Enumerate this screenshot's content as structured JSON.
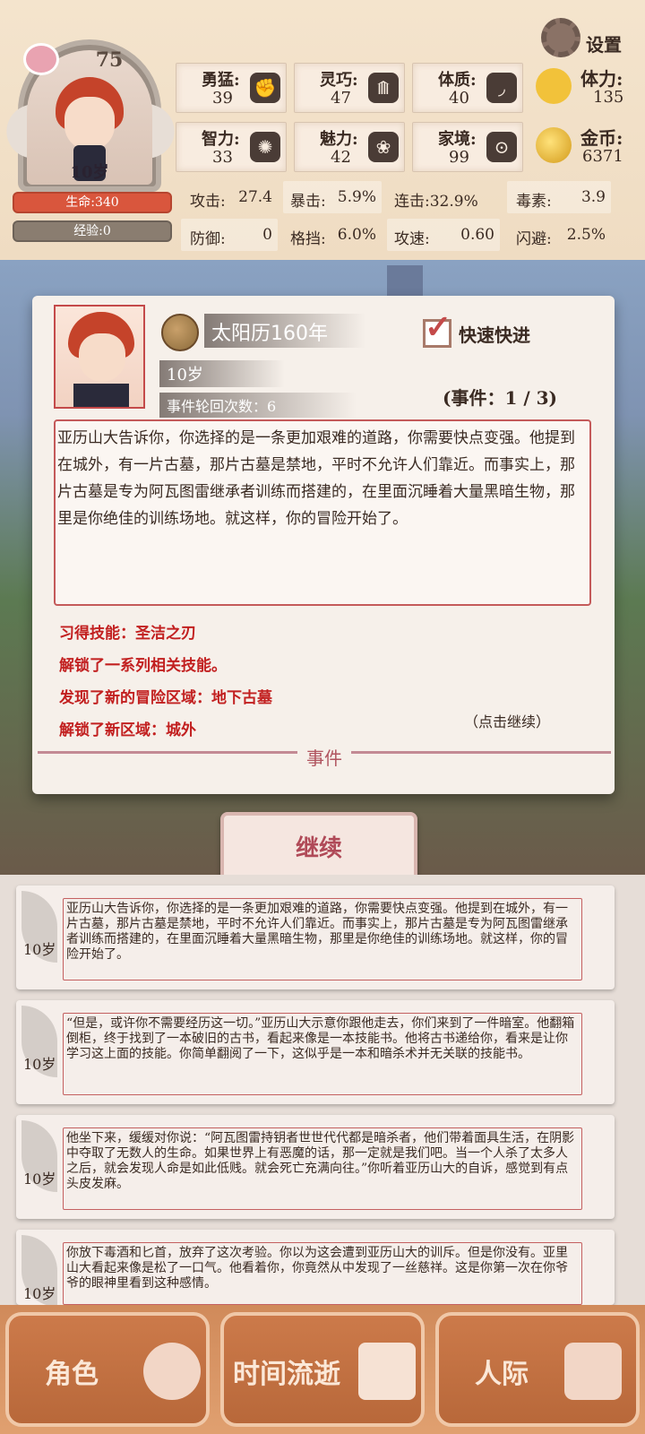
{
  "header": {
    "heart_value": "75",
    "age": "10岁",
    "hp": "生命:340",
    "exp": "经验:0",
    "settings": "设置"
  },
  "attributes": [
    {
      "label": "勇猛:",
      "value": "39",
      "icon": "fist-icon"
    },
    {
      "label": "灵巧:",
      "value": "47",
      "icon": "cloak-icon"
    },
    {
      "label": "体质:",
      "value": "40",
      "icon": "arm-icon"
    },
    {
      "label": "智力:",
      "value": "33",
      "icon": "brain-icon"
    },
    {
      "label": "魅力:",
      "value": "42",
      "icon": "flower-icon"
    },
    {
      "label": "家境:",
      "value": "99",
      "icon": "hand-coin-icon"
    }
  ],
  "resources": {
    "stamina_label": "体力:",
    "stamina_value": "135",
    "gold_label": "金币:",
    "gold_value": "6371"
  },
  "combat": [
    {
      "label": "攻击:",
      "value": "27.4"
    },
    {
      "label": "暴击:",
      "value": "5.9%"
    },
    {
      "label": "连击:32.9%",
      "value": ""
    },
    {
      "label": "毒素:",
      "value": "3.9"
    },
    {
      "label": "防御:",
      "value": "0"
    },
    {
      "label": "格挡:",
      "value": "6.0%"
    },
    {
      "label": "攻速:",
      "value": "0.60"
    },
    {
      "label": "闪避:",
      "value": "2.5%"
    }
  ],
  "event": {
    "year": "太阳历160年",
    "fast_forward": "快速快进",
    "age": "10岁",
    "cycle": "事件轮回次数：6",
    "count": "(事件：1 / 3)",
    "story": "亚历山大告诉你，你选择的是一条更加艰难的道路，你需要快点变强。他提到在城外，有一片古墓，那片古墓是禁地，平时不允许人们靠近。而事实上，那片古墓是专为阿瓦图雷继承者训练而搭建的，在里面沉睡着大量黑暗生物，那里是你绝佳的训练场地。就这样，你的冒险开始了。",
    "rewards": [
      "习得技能：圣洁之刃",
      "解锁了一系列相关技能。",
      "发现了新的冒险区域：地下古墓",
      "解锁了新区域：城外"
    ],
    "click_continue": "（点击继续）",
    "label": "事件"
  },
  "continue_label": "继续",
  "history": [
    {
      "age": "10岁",
      "text": "亚历山大告诉你，你选择的是一条更加艰难的道路，你需要快点变强。他提到在城外，有一片古墓，那片古墓是禁地，平时不允许人们靠近。而事实上，那片古墓是专为阿瓦图雷继承者训练而搭建的，在里面沉睡着大量黑暗生物，那里是你绝佳的训练场地。就这样，你的冒险开始了。"
    },
    {
      "age": "10岁",
      "text": "“但是，或许你不需要经历这一切。”亚历山大示意你跟他走去，你们来到了一件暗室。他翻箱倒柜，终于找到了一本破旧的古书，看起来像是一本技能书。他将古书递给你，看来是让你学习这上面的技能。你简单翻阅了一下，这似乎是一本和暗杀术并无关联的技能书。"
    },
    {
      "age": "10岁",
      "text": "他坐下来，缓缓对你说：“阿瓦图雷持钥者世世代代都是暗杀者，他们带着面具生活，在阴影中夺取了无数人的生命。如果世界上有恶魔的话，那一定就是我们吧。当一个人杀了太多人之后，就会发现人命是如此低贱。就会死亡充满向往。”你听着亚历山大的自诉，感觉到有点头皮发麻。"
    },
    {
      "age": "10岁",
      "text": "你放下毒酒和匕首，放弃了这次考验。你以为这会遭到亚历山大的训斥。但是你没有。亚里山大看起来像是松了一口气。他看着你，你竟然从中发现了一丝慈祥。这是你第一次在你爷爷的眼神里看到这种感情。"
    }
  ],
  "nav": [
    {
      "label": "角色",
      "icon": "character-icon"
    },
    {
      "label": "时间流逝",
      "icon": "hourglass-icon"
    },
    {
      "label": "人际",
      "icon": "people-icon"
    }
  ]
}
